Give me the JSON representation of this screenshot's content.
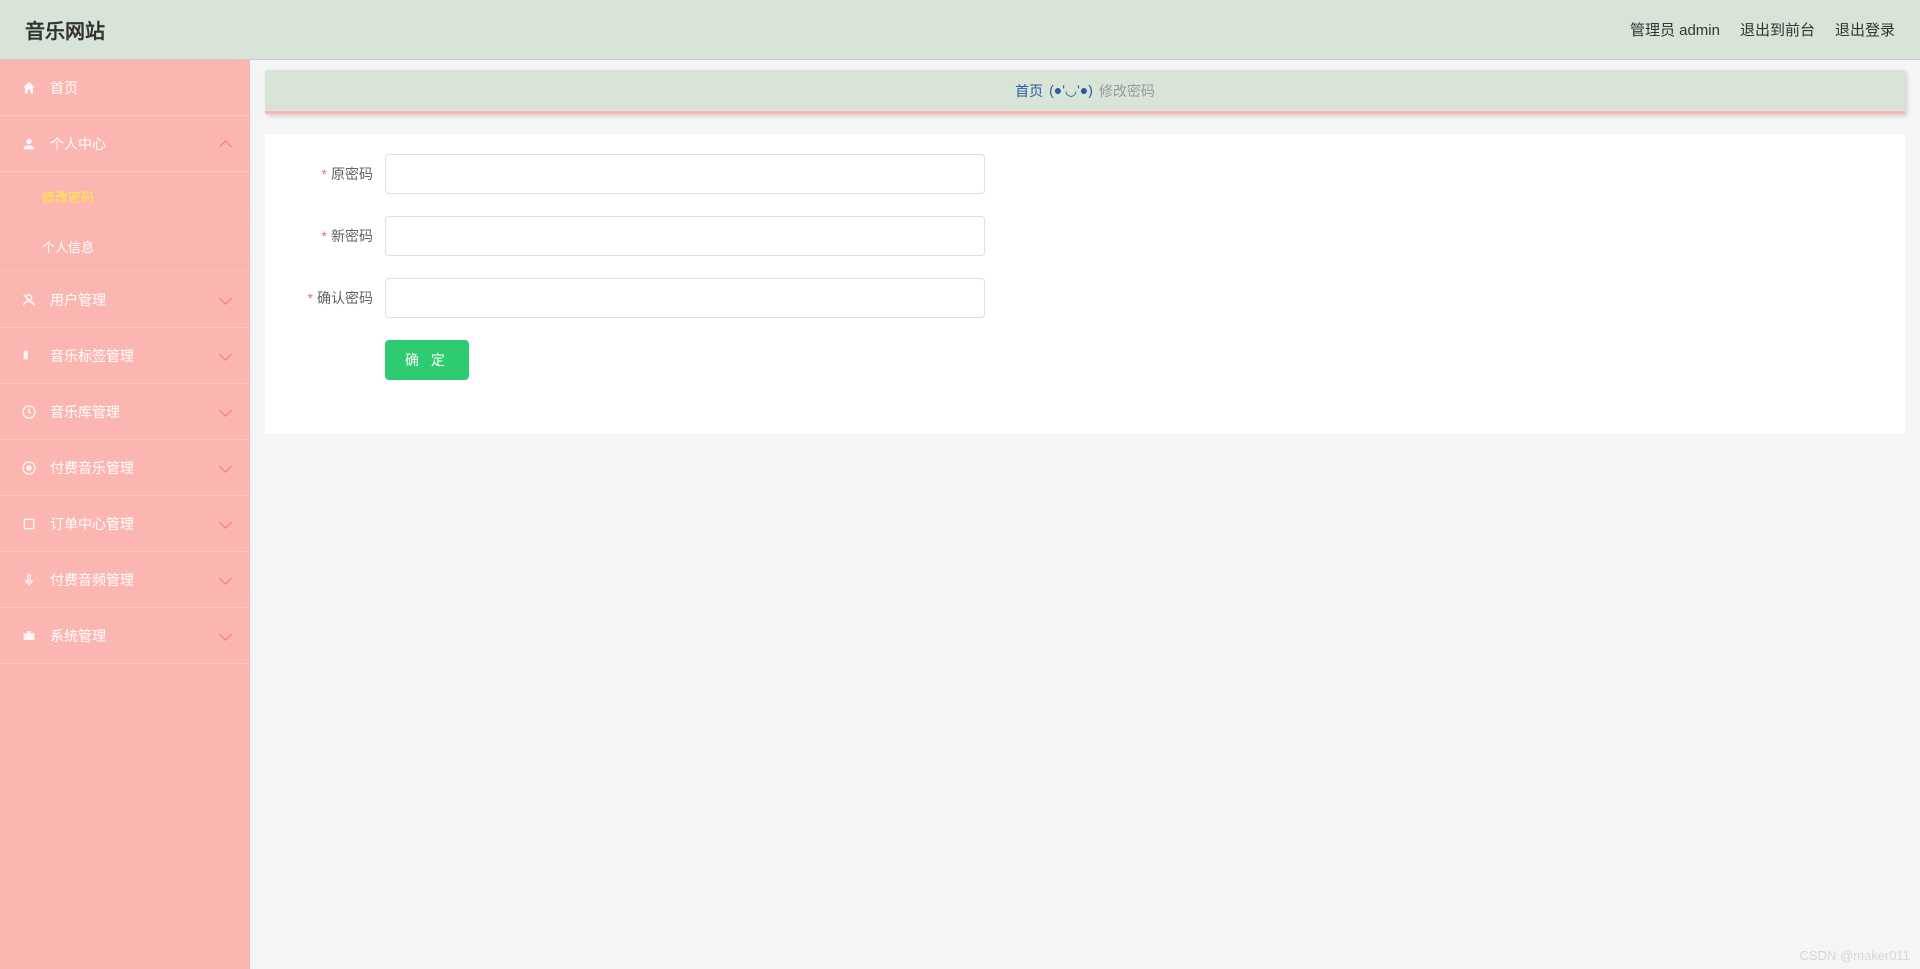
{
  "header": {
    "title": "音乐网站",
    "admin_label": "管理员 admin",
    "exit_front_label": "退出到前台",
    "logout_label": "退出登录"
  },
  "sidebar": {
    "items": [
      {
        "label": "首页",
        "icon": "home-icon",
        "has_children": false
      },
      {
        "label": "个人中心",
        "icon": "person-icon",
        "has_children": true,
        "expanded": true,
        "children": [
          {
            "label": "修改密码",
            "active": true
          },
          {
            "label": "个人信息",
            "active": false
          }
        ]
      },
      {
        "label": "用户管理",
        "icon": "user-manage-icon",
        "has_children": true
      },
      {
        "label": "音乐标签管理",
        "icon": "tag-icon",
        "has_children": true
      },
      {
        "label": "音乐库管理",
        "icon": "library-icon",
        "has_children": true
      },
      {
        "label": "付费音乐管理",
        "icon": "paid-music-icon",
        "has_children": true
      },
      {
        "label": "订单中心管理",
        "icon": "order-icon",
        "has_children": true
      },
      {
        "label": "付费音频管理",
        "icon": "paid-audio-icon",
        "has_children": true
      },
      {
        "label": "系统管理",
        "icon": "system-icon",
        "has_children": true
      }
    ]
  },
  "breadcrumb": {
    "home": "首页",
    "separator": "(●'◡'●)",
    "current": "修改密码"
  },
  "form": {
    "old_password_label": "原密码",
    "new_password_label": "新密码",
    "confirm_password_label": "确认密码",
    "old_password_value": "",
    "new_password_value": "",
    "confirm_password_value": "",
    "submit_label": "确 定"
  },
  "watermark": "CSDN @maker011"
}
